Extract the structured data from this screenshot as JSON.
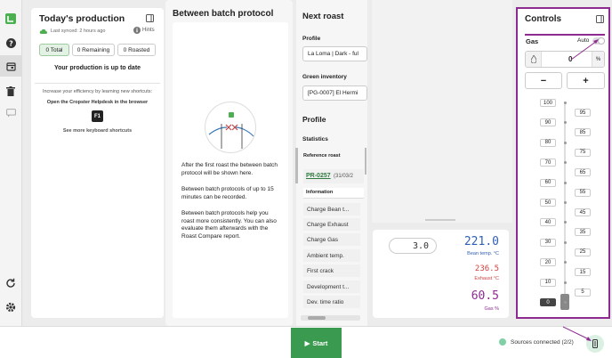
{
  "production": {
    "title": "Today's production",
    "sync_status": "Last synced: 2 hours ago",
    "hints_label": "Hints",
    "filters": [
      "0 Total",
      "0 Remaining",
      "0 Roasted"
    ],
    "up_to_date": "Your production is up to date",
    "shortcut_intro": "Increase your efficiency by learning new shortcuts:",
    "shortcut_helpdesk": "Open the Cropster Helpdesk in the browser",
    "shortcut_key": "F1",
    "more_shortcuts": "See more keyboard shortcuts"
  },
  "batch_protocol": {
    "title": "Between batch protocol",
    "para1": "After the first roast the between batch protocol will be shown here.",
    "para2": "Between batch protocols of up to 15 minutes can be recorded.",
    "para3": "Between batch protocols help you roast more consistently. You can also evaluate them afterwards with the Roast Compare report."
  },
  "next_roast": {
    "title": "Next roast",
    "profile_label": "Profile",
    "profile_value": "La Loma | Dark - ful",
    "green_label": "Green inventory",
    "green_value": "[PG-0007] El Hermi",
    "profile_heading": "Profile",
    "statistics_label": "Statistics",
    "reference_header": "Reference roast",
    "reference_link": "PR-0257",
    "reference_date": "(31/03/2",
    "info_header": "Information",
    "rows": [
      "Charge Bean t...",
      "Charge Exhaust",
      "Charge Gas",
      "Ambient temp.",
      "First crack",
      "Development t...",
      "Dev. time ratio"
    ]
  },
  "readings": {
    "input_value": "3.0",
    "bean_temp": "221.0",
    "bean_label": "Bean temp. °C",
    "exhaust_temp": "236.5",
    "exhaust_label": "Exhaust °C",
    "gas_value": "60.5",
    "gas_label": "Gas %"
  },
  "controls": {
    "title": "Controls",
    "gas_label": "Gas",
    "auto_label": "Auto",
    "gas_value": "0",
    "unit": "%",
    "minus_label": "−",
    "plus_label": "+",
    "left_ticks": [
      "100",
      "90",
      "80",
      "70",
      "60",
      "50",
      "40",
      "30",
      "20",
      "10",
      "0"
    ],
    "right_ticks": [
      "95",
      "85",
      "75",
      "65",
      "55",
      "45",
      "35",
      "25",
      "15",
      "5"
    ]
  },
  "footer": {
    "start_label": "Start",
    "sources_label": "Sources connected (2/2)"
  },
  "colors": {
    "brand_green": "#4caf50",
    "start_green": "#3a9a4f",
    "highlight": "#8e2b91",
    "bean_blue": "#2f5fb3",
    "exhaust_red": "#d04040",
    "gas_purple": "#8e2b91"
  }
}
